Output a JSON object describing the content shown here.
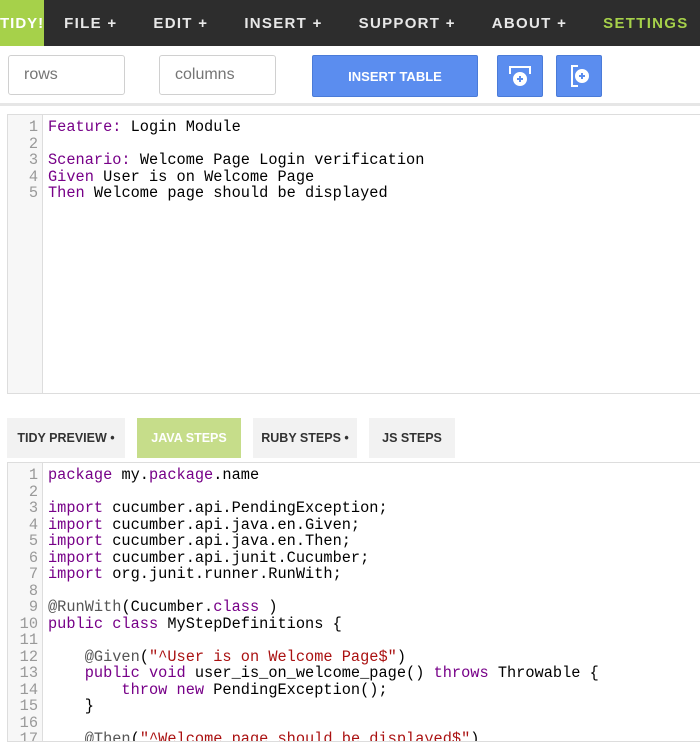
{
  "nav": {
    "brand": "TIDY!",
    "items": [
      "FILE  +",
      "EDIT  +",
      "INSERT  +",
      "SUPPORT  +",
      "ABOUT  +",
      "SETTINGS"
    ]
  },
  "toolbar": {
    "rows_placeholder": "rows",
    "columns_placeholder": "columns",
    "insert_table": "INSERT TABLE"
  },
  "feature_editor": {
    "lines": [
      [
        [
          "kw",
          "Feature:"
        ],
        [
          "",
          "Login Module"
        ]
      ],
      [],
      [
        [
          "kw",
          "Scenario:"
        ],
        [
          "",
          "Welcome Page Login verification"
        ]
      ],
      [
        [
          "kw",
          "Given"
        ],
        [
          "",
          "User is on Welcome Page"
        ]
      ],
      [
        [
          "kw",
          "Then"
        ],
        [
          "",
          "Welcome page should be displayed"
        ]
      ]
    ]
  },
  "tabs": [
    {
      "label": "TIDY PREVIEW •",
      "active": false
    },
    {
      "label": "JAVA STEPS",
      "active": true
    },
    {
      "label": "RUBY STEPS •",
      "active": false
    },
    {
      "label": "JS STEPS",
      "active": false
    }
  ],
  "steps_editor": {
    "lines": [
      [
        [
          "kw",
          "package"
        ],
        [
          "",
          " my."
        ],
        [
          "kw",
          "package"
        ],
        [
          "",
          ".name"
        ]
      ],
      [],
      [
        [
          "kw",
          "import"
        ],
        [
          "",
          " cucumber.api.PendingException;"
        ]
      ],
      [
        [
          "kw",
          "import"
        ],
        [
          "",
          " cucumber.api.java.en.Given;"
        ]
      ],
      [
        [
          "kw",
          "import"
        ],
        [
          "",
          " cucumber.api.java.en.Then;"
        ]
      ],
      [
        [
          "kw",
          "import"
        ],
        [
          "",
          " cucumber.api.junit.Cucumber;"
        ]
      ],
      [
        [
          "kw",
          "import"
        ],
        [
          "",
          " org.junit.runner.RunWith;"
        ]
      ],
      [],
      [
        [
          "meta",
          "@RunWith"
        ],
        [
          "",
          "(Cucumber."
        ],
        [
          "kw",
          "class"
        ],
        [
          "",
          ")"
        ]
      ],
      [
        [
          "kw",
          "public class"
        ],
        [
          "",
          " MyStepDefinitions {"
        ]
      ],
      [],
      [
        [
          "meta",
          "    @Given"
        ],
        [
          "",
          "("
        ],
        [
          "str",
          "\"^User is on Welcome Page$\""
        ],
        [
          "",
          ")"
        ]
      ],
      [
        [
          "kw",
          "    public void"
        ],
        [
          "",
          " user_is_on_welcome_page() "
        ],
        [
          "kw",
          "throws"
        ],
        [
          "",
          " Throwable {"
        ]
      ],
      [
        [
          "kw",
          "        throw new"
        ],
        [
          "",
          " PendingException();"
        ]
      ],
      [
        [
          "",
          "    }"
        ]
      ],
      [],
      [
        [
          "meta",
          "    @Then"
        ],
        [
          "",
          "("
        ],
        [
          "str",
          "\"^Welcome page should be displayed$\""
        ],
        [
          "",
          ")"
        ]
      ]
    ]
  }
}
